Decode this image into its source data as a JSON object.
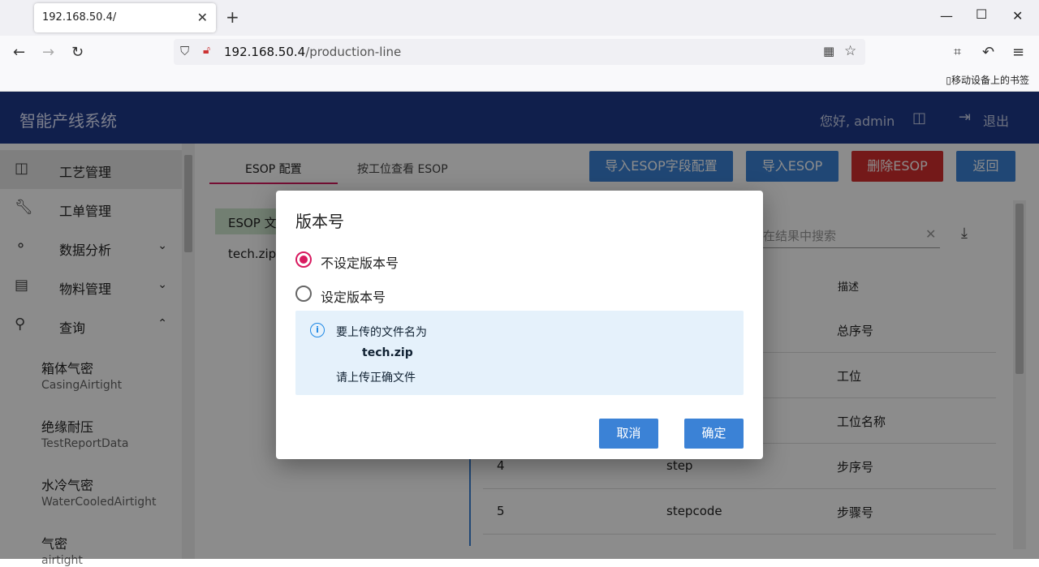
{
  "browser": {
    "tab_title": "192.168.50.4/",
    "url_host": "192.168.50.4",
    "url_path": "/production-line",
    "bookmark": "移动设备上的书签"
  },
  "app": {
    "title": "智能产线系统",
    "greeting": "您好, admin",
    "logout": "退出"
  },
  "sidebar": {
    "items": [
      {
        "label": "工艺管理",
        "icon": "process-icon"
      },
      {
        "label": "工单管理",
        "icon": "wrench-icon"
      },
      {
        "label": "数据分析",
        "icon": "analysis-icon"
      },
      {
        "label": "物料管理",
        "icon": "material-icon"
      },
      {
        "label": "查询",
        "icon": "search-icon"
      }
    ],
    "subitems": [
      {
        "label": "箱体气密",
        "sub": "CasingAirtight"
      },
      {
        "label": "绝缘耐压",
        "sub": "TestReportData"
      },
      {
        "label": "水冷气密",
        "sub": "WaterCooledAirtight"
      },
      {
        "label": "气密",
        "sub": "airtight"
      }
    ]
  },
  "main": {
    "tabs": [
      "ESOP 配置",
      "按工位查看 ESOP"
    ],
    "buttons": [
      "导入ESOP字段配置",
      "导入ESOP",
      "删除ESOP",
      "返回"
    ],
    "file_panel_title": "ESOP 文",
    "file_name": "tech.zip",
    "search_placeholder": "在结果中搜索",
    "table_header": "描述",
    "rows": [
      {
        "no": "",
        "field": "",
        "desc": "总序号"
      },
      {
        "no": "",
        "field": "",
        "desc": "工位"
      },
      {
        "no": "",
        "field": "",
        "desc": "工位名称"
      },
      {
        "no": "4",
        "field": "step",
        "desc": "步序号"
      },
      {
        "no": "5",
        "field": "stepcode",
        "desc": "步骤号"
      }
    ]
  },
  "dialog": {
    "title": "版本号",
    "option1": "不设定版本号",
    "option2": "设定版本号",
    "info_line1": "要上传的文件名为",
    "info_file": "tech.zip",
    "info_line3": "请上传正确文件",
    "cancel": "取消",
    "confirm": "确定"
  }
}
